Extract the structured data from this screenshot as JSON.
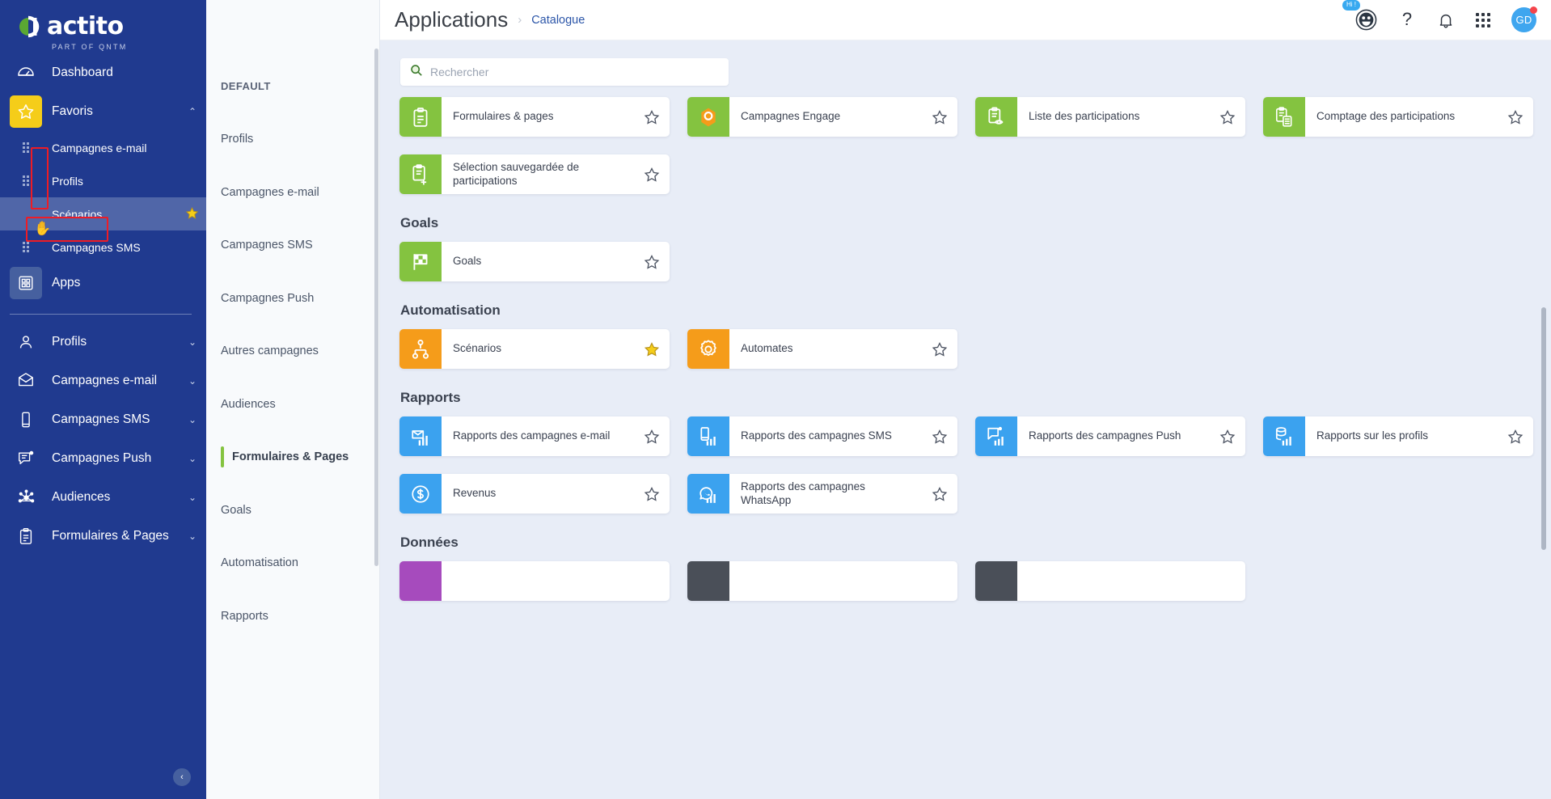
{
  "brand": {
    "name": "actito",
    "tagline": "PART OF QNTM"
  },
  "sidebar": {
    "primary": [
      {
        "label": "Dashboard",
        "icon": "dashboard-icon"
      },
      {
        "label": "Favoris",
        "icon": "star-icon",
        "chevron": "⌃"
      }
    ],
    "favorites": [
      {
        "label": "Campagnes e-mail"
      },
      {
        "label": "Profils"
      },
      {
        "label": "Scénarios",
        "active": true
      },
      {
        "label": "Campagnes SMS"
      }
    ],
    "apps": {
      "label": "Apps",
      "icon": "apps-grid-icon"
    },
    "sections": [
      {
        "label": "Profils",
        "icon": "user-icon",
        "chevron": "⌄"
      },
      {
        "label": "Campagnes e-mail",
        "icon": "envelope-icon",
        "chevron": "⌄"
      },
      {
        "label": "Campagnes SMS",
        "icon": "phone-icon",
        "chevron": "⌄"
      },
      {
        "label": "Campagnes Push",
        "icon": "push-icon",
        "chevron": "⌄"
      },
      {
        "label": "Audiences",
        "icon": "network-icon",
        "chevron": "⌄"
      },
      {
        "label": "Formulaires & Pages",
        "icon": "clipboard-icon",
        "chevron": "⌄"
      }
    ],
    "collapse_label": "‹"
  },
  "categories": [
    {
      "label": "DEFAULT",
      "heading": true
    },
    {
      "label": "Profils"
    },
    {
      "label": "Campagnes e-mail"
    },
    {
      "label": "Campagnes SMS"
    },
    {
      "label": "Campagnes Push"
    },
    {
      "label": "Autres campagnes"
    },
    {
      "label": "Audiences"
    },
    {
      "label": "Formulaires & Pages",
      "active": true
    },
    {
      "label": "Goals"
    },
    {
      "label": "Automatisation"
    },
    {
      "label": "Rapports"
    }
  ],
  "header": {
    "title": "Applications",
    "breadcrumb_separator": "›",
    "breadcrumb_current": "Catalogue",
    "chat_badge": "Hi !",
    "help_label": "?",
    "avatar_initials": "GD"
  },
  "search": {
    "placeholder": "Rechercher",
    "value": ""
  },
  "sections": [
    {
      "title": "",
      "cards": [
        {
          "label": "Formulaires & pages",
          "color": "green",
          "icon": "clipboard-icon",
          "fav": false
        },
        {
          "label": "Campagnes Engage",
          "color": "green",
          "icon": "engage-hex-icon",
          "fav": false
        },
        {
          "label": "Liste des participations",
          "color": "green",
          "icon": "clipboard-eye-icon",
          "fav": false
        },
        {
          "label": "Comptage des participations",
          "color": "green",
          "icon": "clipboard-calc-icon",
          "fav": false
        },
        {
          "label": "Sélection sauvegardée de participations",
          "color": "green",
          "icon": "clipboard-plus-icon",
          "fav": false
        }
      ]
    },
    {
      "title": "Goals",
      "cards": [
        {
          "label": "Goals",
          "color": "green",
          "icon": "flag-icon",
          "fav": false
        }
      ]
    },
    {
      "title": "Automatisation",
      "cards": [
        {
          "label": "Scénarios",
          "color": "orange",
          "icon": "scenario-tree-icon",
          "fav": true
        },
        {
          "label": "Automates",
          "color": "orange",
          "icon": "gear-icon",
          "fav": false
        }
      ]
    },
    {
      "title": "Rapports",
      "cards": [
        {
          "label": "Rapports des campagnes e-mail",
          "color": "blue",
          "icon": "report-mail-icon",
          "fav": false
        },
        {
          "label": "Rapports des campagnes SMS",
          "color": "blue",
          "icon": "report-sms-icon",
          "fav": false
        },
        {
          "label": "Rapports des campagnes Push",
          "color": "blue",
          "icon": "report-push-icon",
          "fav": false
        },
        {
          "label": "Rapports sur les profils",
          "color": "blue",
          "icon": "report-profiles-icon",
          "fav": false
        },
        {
          "label": "Revenus",
          "color": "blue",
          "icon": "dollar-icon",
          "fav": false
        },
        {
          "label": "Rapports des campagnes WhatsApp",
          "color": "blue",
          "icon": "report-whatsapp-icon",
          "fav": false
        }
      ]
    },
    {
      "title": "Données",
      "cards": [
        {
          "label": "",
          "color": "purple",
          "icon": "data-icon",
          "fav": false
        },
        {
          "label": "",
          "color": "dark",
          "icon": "data-icon",
          "fav": false
        },
        {
          "label": "",
          "color": "dark",
          "icon": "data-icon",
          "fav": false
        }
      ]
    }
  ],
  "colors": {
    "sidebar_bg": "#203a8f",
    "accent_green": "#84c340",
    "accent_orange": "#f59c1a",
    "accent_blue": "#3ba2ef",
    "favorite_yellow": "#f5cd19",
    "content_bg": "#e8edf7",
    "highlight_red": "#ee1c25"
  }
}
